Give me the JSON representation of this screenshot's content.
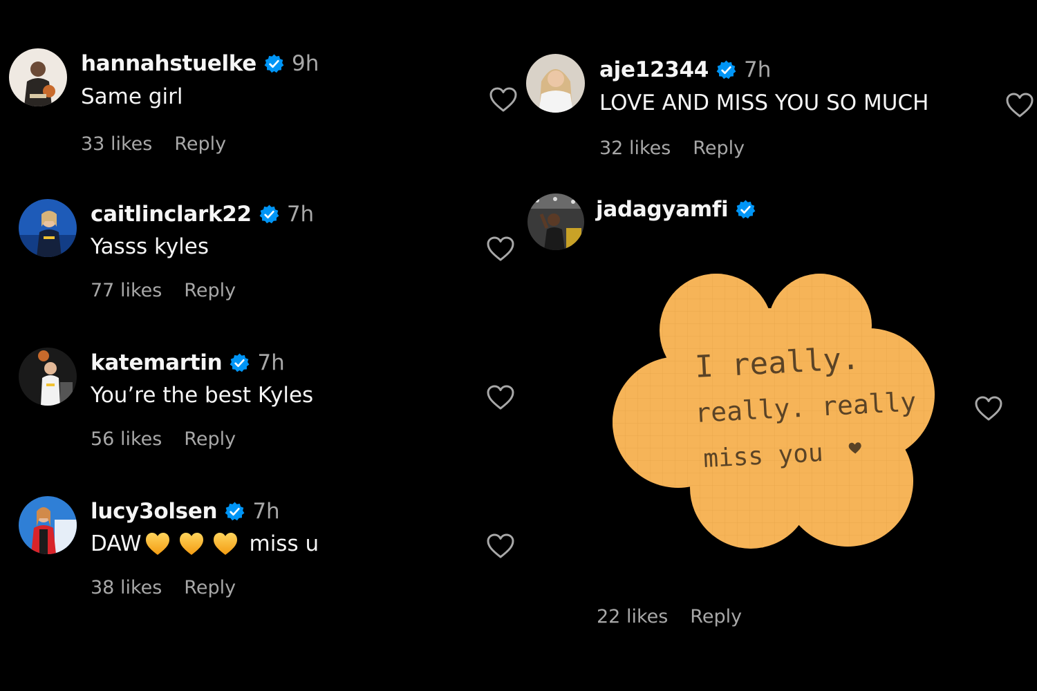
{
  "colors": {
    "background": "#000000",
    "text": "#f5f5f5",
    "secondary": "#a8a8a8",
    "verified": "#0095f6",
    "emoji_heart": "#f7b731",
    "sticker_fill": "#f6b458",
    "sticker_ink": "#5a4326"
  },
  "icons": {
    "verified": "verified-badge-icon",
    "like": "heart-outline-icon",
    "emoji": "yellow-heart-emoji"
  },
  "comments": [
    {
      "username": "hannahstuelke",
      "time": "9h",
      "text": "Same girl",
      "likes": "33 likes",
      "reply": "Reply"
    },
    {
      "username": "caitlinclark22",
      "time": "7h",
      "text": "Yasss kyles",
      "likes": "77 likes",
      "reply": "Reply"
    },
    {
      "username": "katemartin",
      "time": "7h",
      "text": "You’re the best Kyles",
      "likes": "56 likes",
      "reply": "Reply"
    },
    {
      "username": "lucy3olsen",
      "time": "7h",
      "text_prefix": "DAW",
      "text_suffix": "miss u",
      "likes": "38 likes",
      "reply": "Reply"
    },
    {
      "username": "aje12344",
      "time": "7h",
      "text": "LOVE AND MISS YOU SO MUCH",
      "likes": "32 likes",
      "reply": "Reply"
    },
    {
      "username": "jadagyamfi",
      "sticker_lines": [
        "I really.",
        "really. really",
        "miss you"
      ],
      "likes": "22 likes",
      "reply": "Reply"
    }
  ]
}
